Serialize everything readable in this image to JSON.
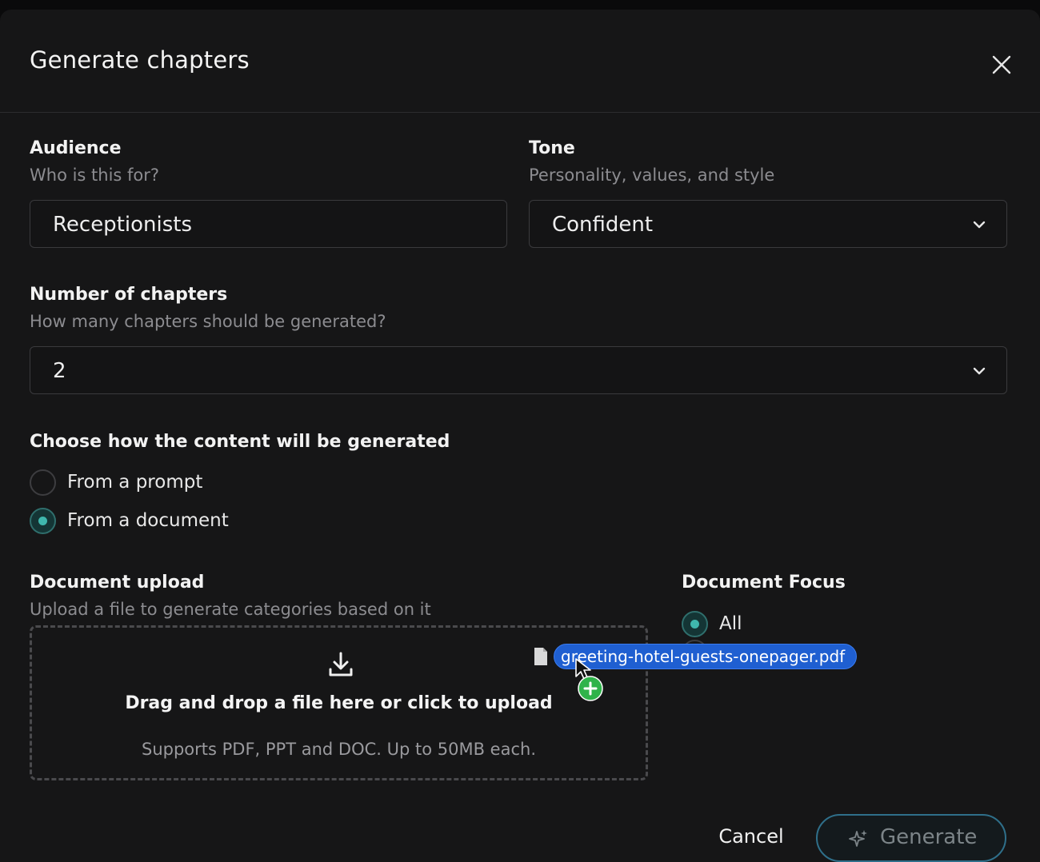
{
  "dialog": {
    "title": "Generate chapters"
  },
  "audience": {
    "label": "Audience",
    "sublabel": "Who is this for?",
    "value": "Receptionists"
  },
  "tone": {
    "label": "Tone",
    "sublabel": "Personality, values, and style",
    "value": "Confident"
  },
  "chapters": {
    "label": "Number of chapters",
    "sublabel": "How many chapters should be generated?",
    "value": "2"
  },
  "content_mode": {
    "label": "Choose how the content will be generated",
    "options": [
      {
        "label": "From a prompt",
        "checked": false
      },
      {
        "label": "From a document",
        "checked": true
      }
    ]
  },
  "upload": {
    "label": "Document upload",
    "sublabel": "Upload a file to generate categories based on it",
    "drop_text": "Drag and drop a file here or click to upload",
    "support_text": "Supports PDF, PPT and DOC. Up to 50MB each."
  },
  "focus": {
    "label": "Document Focus",
    "options": [
      {
        "label": "All",
        "checked": true
      }
    ]
  },
  "drag": {
    "filename": "greeting-hotel-guests-onepager.pdf"
  },
  "footer": {
    "cancel_label": "Cancel",
    "generate_label": "Generate"
  },
  "colors": {
    "accent": "#3fb7ad",
    "drag_pill": "#1f5fd1",
    "plus_badge": "#2fb34a"
  }
}
